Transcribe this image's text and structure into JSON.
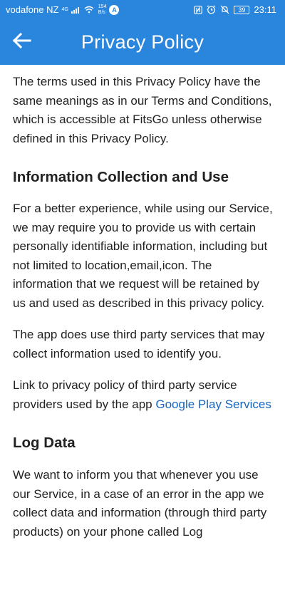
{
  "status_bar": {
    "carrier": "vodafone NZ",
    "network_type": "4G",
    "speed_value": "154",
    "speed_unit": "B/s",
    "nav_letter": "A",
    "battery": "39",
    "time": "23:11"
  },
  "app_bar": {
    "title": "Privacy Policy"
  },
  "content": {
    "intro": "The terms used in this Privacy Policy have the same meanings as in our Terms and Conditions, which is accessible at FitsGo unless otherwise defined in this Privacy Policy.",
    "section1_heading": "Information Collection and Use",
    "section1_p1": "For a better experience, while using our Service, we may require you to provide us with certain personally identifiable information, including but not limited to location,email,icon. The information that we request will be retained by us and used as described in this privacy policy.",
    "section1_p2": "The app does use third party services that may collect information used to identify you.",
    "section1_p3_text": "Link to privacy policy of third party service providers used by the app ",
    "section1_p3_link": "Google Play Services",
    "section2_heading": "Log Data",
    "section2_p1": "We want to inform you that whenever you use our Service, in a case of an error in the app we collect data and information (through third party products) on your phone called Log"
  }
}
